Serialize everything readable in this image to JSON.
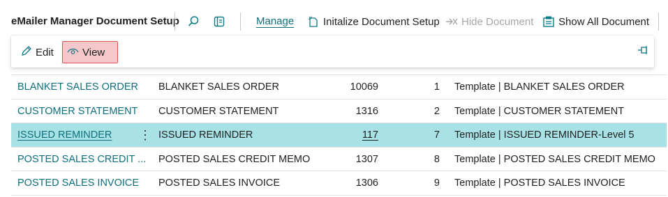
{
  "header": {
    "title": "eMailer Manager Document Setup",
    "manage_label": "Manage",
    "initialize_label": "Initalize Document Setup",
    "hide_label": "Hide Document",
    "show_all_label": "Show All Document"
  },
  "actions": {
    "edit_label": "Edit",
    "view_label": "View"
  },
  "colors": {
    "accent": "#0e6f7a",
    "selected_row": "#a8e2e6",
    "view_highlight": "#f4c7cb"
  },
  "rows": [
    {
      "code": "BLANKET SALES ORDER",
      "description": "BLANKET SALES ORDER",
      "report_id": "10069",
      "no": "1",
      "template": "Template | BLANKET SALES ORDER"
    },
    {
      "code": "CUSTOMER STATEMENT",
      "description": "CUSTOMER STATEMENT",
      "report_id": "1316",
      "no": "2",
      "template": "Template | CUSTOMER STATEMENT"
    },
    {
      "code": "ISSUED REMINDER",
      "description": "ISSUED REMINDER",
      "report_id": "117",
      "no": "7",
      "template": "Template | ISSUED REMINDER-Level 5"
    },
    {
      "code": "POSTED SALES CREDIT ...",
      "description": "POSTED SALES CREDIT MEMO",
      "report_id": "1307",
      "no": "8",
      "template": "Template | POSTED SALES CREDIT MEMO"
    },
    {
      "code": "POSTED SALES INVOICE",
      "description": "POSTED SALES INVOICE",
      "report_id": "1306",
      "no": "9",
      "template": "Template | POSTED SALES INVOICE"
    }
  ]
}
